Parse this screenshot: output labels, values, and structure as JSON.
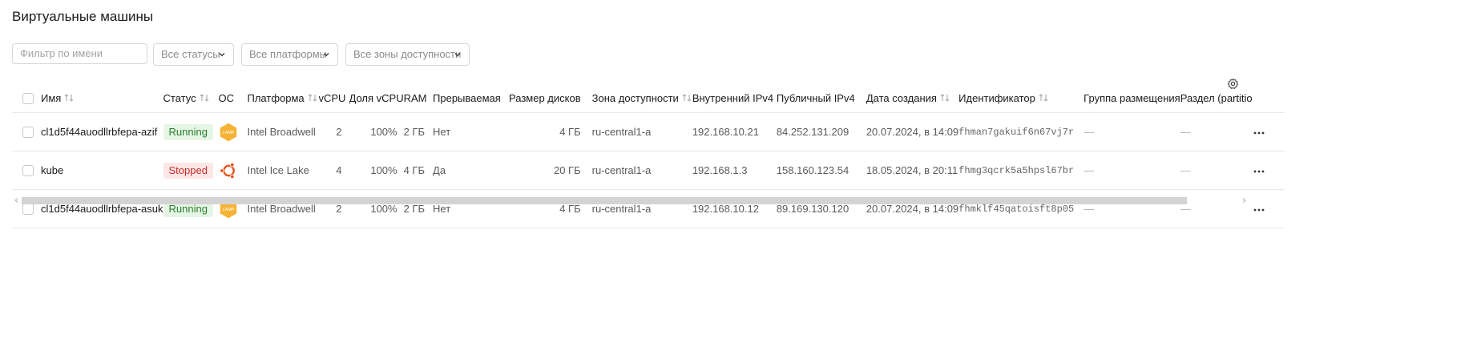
{
  "page": {
    "title": "Виртуальные машины"
  },
  "filters": {
    "name_placeholder": "Фильтр по имени",
    "status_select": "Все статусы",
    "platform_select": "Все платформы",
    "zone_select": "Все зоны доступности"
  },
  "table": {
    "columns": {
      "name": "Имя",
      "status": "Статус",
      "os": "ОС",
      "platform": "Платформа",
      "vcpu": "vCPU",
      "vcpu_share": "Доля vCPU",
      "ram": "RAM",
      "preemptible": "Прерываемая",
      "disk_size": "Размер дисков",
      "zone": "Зона доступности",
      "internal_ip": "Внутренний IPv4",
      "public_ip": "Публичный IPv4",
      "created": "Дата создания",
      "id": "Идентификатор",
      "placement_group": "Группа размещения",
      "partition": "Раздел (partitio"
    },
    "rows": [
      {
        "name": "cl1d5f44auodllrbfepa-azif",
        "status": "Running",
        "status_color": "#2a7d2a",
        "os_icon": "lamp-icon",
        "os_label": "LAMP",
        "platform": "Intel Broadwell",
        "vcpu": "2",
        "vcpu_share": "100%",
        "ram": "2 ГБ",
        "preemptible": "Нет",
        "disk_size": "4 ГБ",
        "zone": "ru-central1-a",
        "internal_ip": "192.168.10.21",
        "public_ip": "84.252.131.209",
        "created": "20.07.2024, в 14:09",
        "id": "fhman7gakuif6n67vj7r",
        "placement_group": "—",
        "partition": "—"
      },
      {
        "name": "kube",
        "status": "Stopped",
        "status_color": "#c52b2b",
        "os_icon": "ubuntu-icon",
        "platform": "Intel Ice Lake",
        "vcpu": "4",
        "vcpu_share": "100%",
        "ram": "4 ГБ",
        "preemptible": "Да",
        "disk_size": "20 ГБ",
        "zone": "ru-central1-a",
        "internal_ip": "192.168.1.3",
        "public_ip": "158.160.123.54",
        "created": "18.05.2024, в 20:11",
        "id": "fhmg3qcrk5a5hpsl67br",
        "placement_group": "—",
        "partition": "—"
      },
      {
        "name": "cl1d5f44auodllrbfepa-asuk",
        "status": "Running",
        "status_color": "#2a7d2a",
        "os_icon": "lamp-icon",
        "os_label": "LAMP",
        "platform": "Intel Broadwell",
        "vcpu": "2",
        "vcpu_share": "100%",
        "ram": "2 ГБ",
        "preemptible": "Нет",
        "disk_size": "4 ГБ",
        "zone": "ru-central1-a",
        "internal_ip": "192.168.10.12",
        "public_ip": "89.169.130.120",
        "created": "20.07.2024, в 14:09",
        "id": "fhmklf45qatoisft8p05",
        "placement_group": "—",
        "partition": "—"
      }
    ]
  },
  "icons": {
    "settings": "gear-icon",
    "row_menu": "more-horizontal-icon",
    "sort": "sort-arrows-icon",
    "dropdown": "chevron-down-icon"
  },
  "colors": {
    "running_bg": "#e6f6e6",
    "stopped_bg": "#fde6e6",
    "lamp_orange": "#f5b335",
    "ubuntu_orange": "#e95420"
  }
}
